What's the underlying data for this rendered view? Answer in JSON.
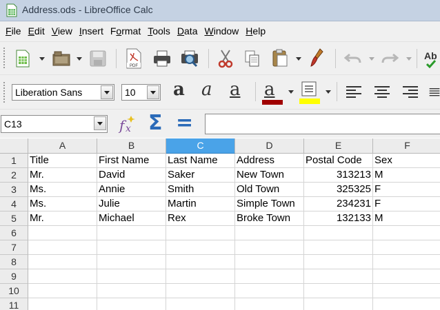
{
  "window": {
    "title": "Address.ods - LibreOffice Calc"
  },
  "menu": [
    {
      "key": "F",
      "rest": "ile"
    },
    {
      "key": "E",
      "rest": "dit"
    },
    {
      "key": "V",
      "rest": "iew"
    },
    {
      "key": "I",
      "rest": "nsert"
    },
    {
      "key": "",
      "pre": "F",
      "key2": "o",
      "rest": "rmat"
    },
    {
      "key": "T",
      "rest": "ools"
    },
    {
      "key": "D",
      "rest": "ata"
    },
    {
      "key": "W",
      "rest": "indow"
    },
    {
      "key": "H",
      "rest": "elp"
    }
  ],
  "toolbar": {
    "spell_label": "Ab",
    "pdf_label": "PDF"
  },
  "formatting": {
    "font_name": "Liberation Sans",
    "font_size": "10",
    "bold_glyph": "a",
    "italic_glyph": "a",
    "underline_glyph": "a",
    "font_color_glyph": "a",
    "font_color": "#a00000",
    "highlight_color": "#ffff00"
  },
  "formula_bar": {
    "cell_ref": "C13",
    "sum_glyph": "Σ",
    "equals_glyph": "=",
    "content": ""
  },
  "sheet": {
    "columns": [
      "A",
      "B",
      "C",
      "D",
      "E",
      "F"
    ],
    "selected_column": "C",
    "row_numbers": [
      "1",
      "2",
      "3",
      "4",
      "5",
      "6",
      "7",
      "8",
      "9",
      "10",
      "11"
    ],
    "header": [
      "Title",
      "First Name",
      "Last Name",
      "Address",
      "Postal Code",
      "Sex"
    ],
    "rows": [
      [
        "Mr.",
        "David",
        "Saker",
        "New Town",
        "313213",
        "M"
      ],
      [
        "Ms.",
        "Annie",
        "Smith",
        "Old Town",
        "325325",
        "F"
      ],
      [
        "Ms.",
        "Julie",
        "Martin",
        "Simple Town",
        "234231",
        "F"
      ],
      [
        "Mr.",
        "Michael",
        "Rex",
        "Broke Town",
        "132133",
        "M"
      ]
    ]
  }
}
